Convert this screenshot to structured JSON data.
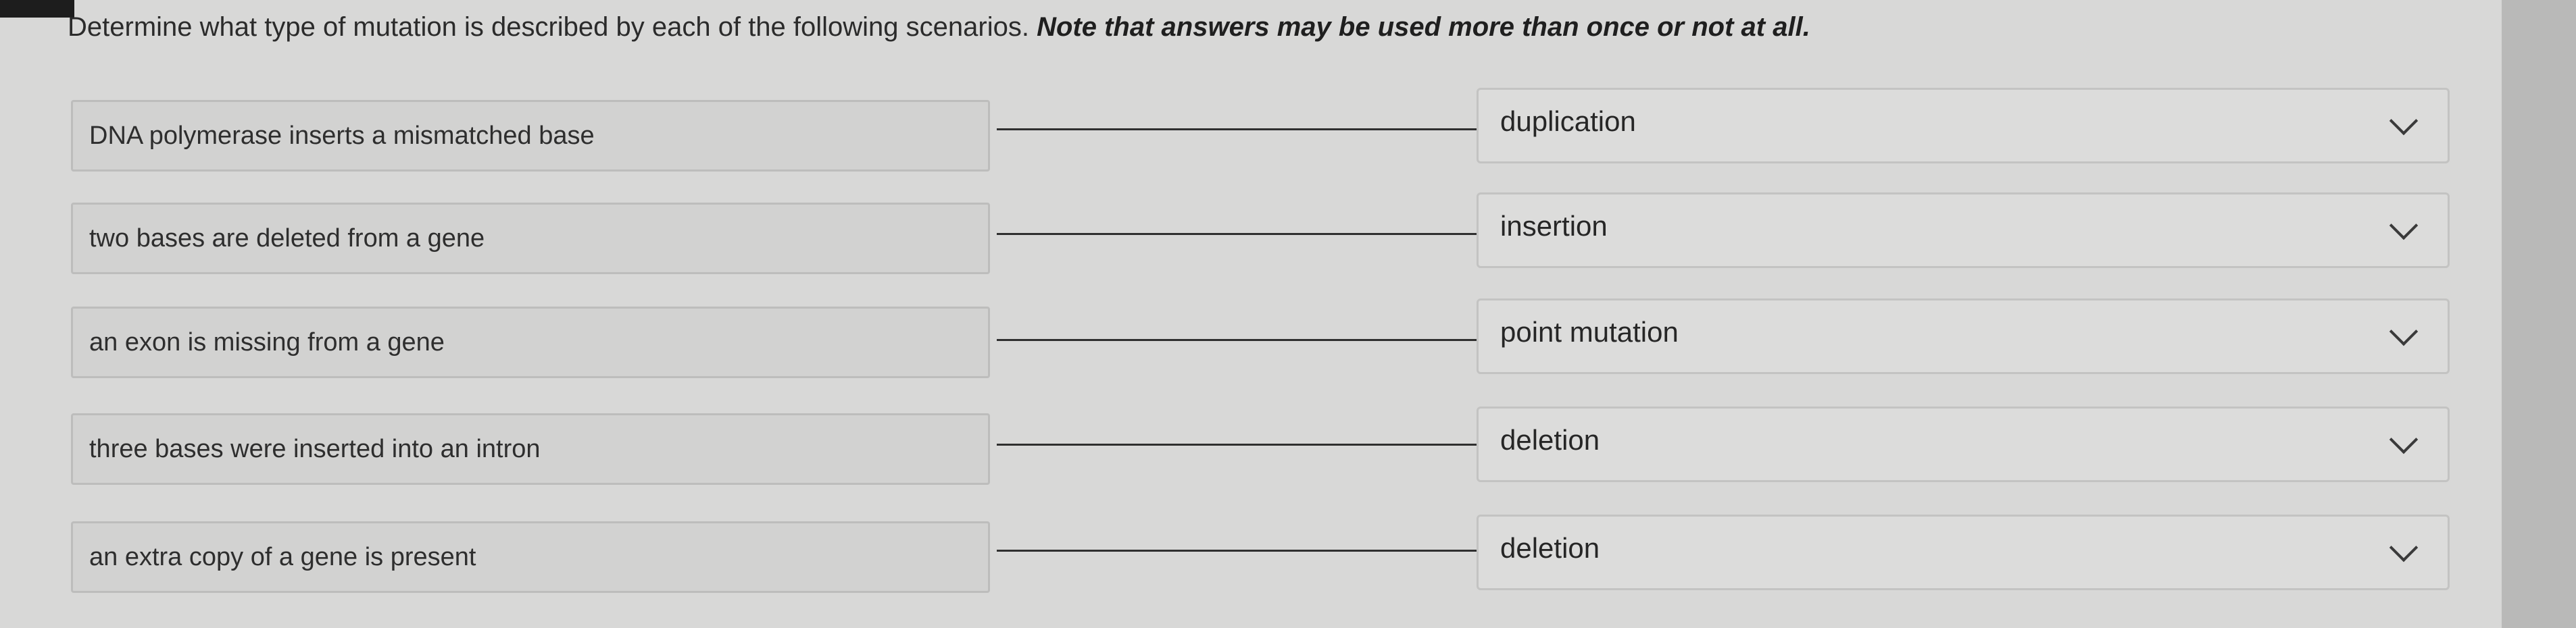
{
  "instruction": {
    "text": "Determine what type of mutation is described by each of the following scenarios. ",
    "note": "Note that answers may be used more than once or not at all."
  },
  "rows": [
    {
      "prompt": "DNA polymerase inserts a mismatched base",
      "answer": "duplication"
    },
    {
      "prompt": "two bases are deleted from a gene",
      "answer": "insertion"
    },
    {
      "prompt": "an exon is missing from a gene",
      "answer": "point mutation"
    },
    {
      "prompt": "three bases were inserted into an intron",
      "answer": "deletion"
    },
    {
      "prompt": "an extra copy of a gene is present",
      "answer": "deletion"
    }
  ],
  "icons": {
    "dropdown": "chevron-down-icon"
  },
  "colors": {
    "background": "#d8d8d7",
    "connector": "#2f2f2f",
    "text": "#2e2e2e"
  }
}
